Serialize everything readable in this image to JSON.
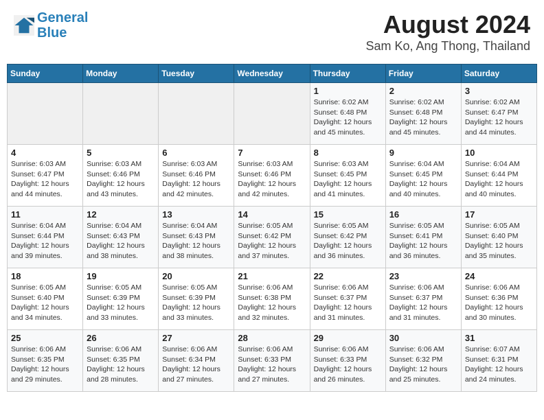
{
  "header": {
    "logo_line1": "General",
    "logo_line2": "Blue",
    "title": "August 2024",
    "subtitle": "Sam Ko, Ang Thong, Thailand"
  },
  "columns": [
    "Sunday",
    "Monday",
    "Tuesday",
    "Wednesday",
    "Thursday",
    "Friday",
    "Saturday"
  ],
  "weeks": [
    {
      "days": [
        {
          "num": "",
          "info": ""
        },
        {
          "num": "",
          "info": ""
        },
        {
          "num": "",
          "info": ""
        },
        {
          "num": "",
          "info": ""
        },
        {
          "num": "1",
          "info": "Sunrise: 6:02 AM\nSunset: 6:48 PM\nDaylight: 12 hours\nand 45 minutes."
        },
        {
          "num": "2",
          "info": "Sunrise: 6:02 AM\nSunset: 6:48 PM\nDaylight: 12 hours\nand 45 minutes."
        },
        {
          "num": "3",
          "info": "Sunrise: 6:02 AM\nSunset: 6:47 PM\nDaylight: 12 hours\nand 44 minutes."
        }
      ]
    },
    {
      "days": [
        {
          "num": "4",
          "info": "Sunrise: 6:03 AM\nSunset: 6:47 PM\nDaylight: 12 hours\nand 44 minutes."
        },
        {
          "num": "5",
          "info": "Sunrise: 6:03 AM\nSunset: 6:46 PM\nDaylight: 12 hours\nand 43 minutes."
        },
        {
          "num": "6",
          "info": "Sunrise: 6:03 AM\nSunset: 6:46 PM\nDaylight: 12 hours\nand 42 minutes."
        },
        {
          "num": "7",
          "info": "Sunrise: 6:03 AM\nSunset: 6:46 PM\nDaylight: 12 hours\nand 42 minutes."
        },
        {
          "num": "8",
          "info": "Sunrise: 6:03 AM\nSunset: 6:45 PM\nDaylight: 12 hours\nand 41 minutes."
        },
        {
          "num": "9",
          "info": "Sunrise: 6:04 AM\nSunset: 6:45 PM\nDaylight: 12 hours\nand 40 minutes."
        },
        {
          "num": "10",
          "info": "Sunrise: 6:04 AM\nSunset: 6:44 PM\nDaylight: 12 hours\nand 40 minutes."
        }
      ]
    },
    {
      "days": [
        {
          "num": "11",
          "info": "Sunrise: 6:04 AM\nSunset: 6:44 PM\nDaylight: 12 hours\nand 39 minutes."
        },
        {
          "num": "12",
          "info": "Sunrise: 6:04 AM\nSunset: 6:43 PM\nDaylight: 12 hours\nand 38 minutes."
        },
        {
          "num": "13",
          "info": "Sunrise: 6:04 AM\nSunset: 6:43 PM\nDaylight: 12 hours\nand 38 minutes."
        },
        {
          "num": "14",
          "info": "Sunrise: 6:05 AM\nSunset: 6:42 PM\nDaylight: 12 hours\nand 37 minutes."
        },
        {
          "num": "15",
          "info": "Sunrise: 6:05 AM\nSunset: 6:42 PM\nDaylight: 12 hours\nand 36 minutes."
        },
        {
          "num": "16",
          "info": "Sunrise: 6:05 AM\nSunset: 6:41 PM\nDaylight: 12 hours\nand 36 minutes."
        },
        {
          "num": "17",
          "info": "Sunrise: 6:05 AM\nSunset: 6:40 PM\nDaylight: 12 hours\nand 35 minutes."
        }
      ]
    },
    {
      "days": [
        {
          "num": "18",
          "info": "Sunrise: 6:05 AM\nSunset: 6:40 PM\nDaylight: 12 hours\nand 34 minutes."
        },
        {
          "num": "19",
          "info": "Sunrise: 6:05 AM\nSunset: 6:39 PM\nDaylight: 12 hours\nand 33 minutes."
        },
        {
          "num": "20",
          "info": "Sunrise: 6:05 AM\nSunset: 6:39 PM\nDaylight: 12 hours\nand 33 minutes."
        },
        {
          "num": "21",
          "info": "Sunrise: 6:06 AM\nSunset: 6:38 PM\nDaylight: 12 hours\nand 32 minutes."
        },
        {
          "num": "22",
          "info": "Sunrise: 6:06 AM\nSunset: 6:37 PM\nDaylight: 12 hours\nand 31 minutes."
        },
        {
          "num": "23",
          "info": "Sunrise: 6:06 AM\nSunset: 6:37 PM\nDaylight: 12 hours\nand 31 minutes."
        },
        {
          "num": "24",
          "info": "Sunrise: 6:06 AM\nSunset: 6:36 PM\nDaylight: 12 hours\nand 30 minutes."
        }
      ]
    },
    {
      "days": [
        {
          "num": "25",
          "info": "Sunrise: 6:06 AM\nSunset: 6:35 PM\nDaylight: 12 hours\nand 29 minutes."
        },
        {
          "num": "26",
          "info": "Sunrise: 6:06 AM\nSunset: 6:35 PM\nDaylight: 12 hours\nand 28 minutes."
        },
        {
          "num": "27",
          "info": "Sunrise: 6:06 AM\nSunset: 6:34 PM\nDaylight: 12 hours\nand 27 minutes."
        },
        {
          "num": "28",
          "info": "Sunrise: 6:06 AM\nSunset: 6:33 PM\nDaylight: 12 hours\nand 27 minutes."
        },
        {
          "num": "29",
          "info": "Sunrise: 6:06 AM\nSunset: 6:33 PM\nDaylight: 12 hours\nand 26 minutes."
        },
        {
          "num": "30",
          "info": "Sunrise: 6:06 AM\nSunset: 6:32 PM\nDaylight: 12 hours\nand 25 minutes."
        },
        {
          "num": "31",
          "info": "Sunrise: 6:07 AM\nSunset: 6:31 PM\nDaylight: 12 hours\nand 24 minutes."
        }
      ]
    }
  ]
}
